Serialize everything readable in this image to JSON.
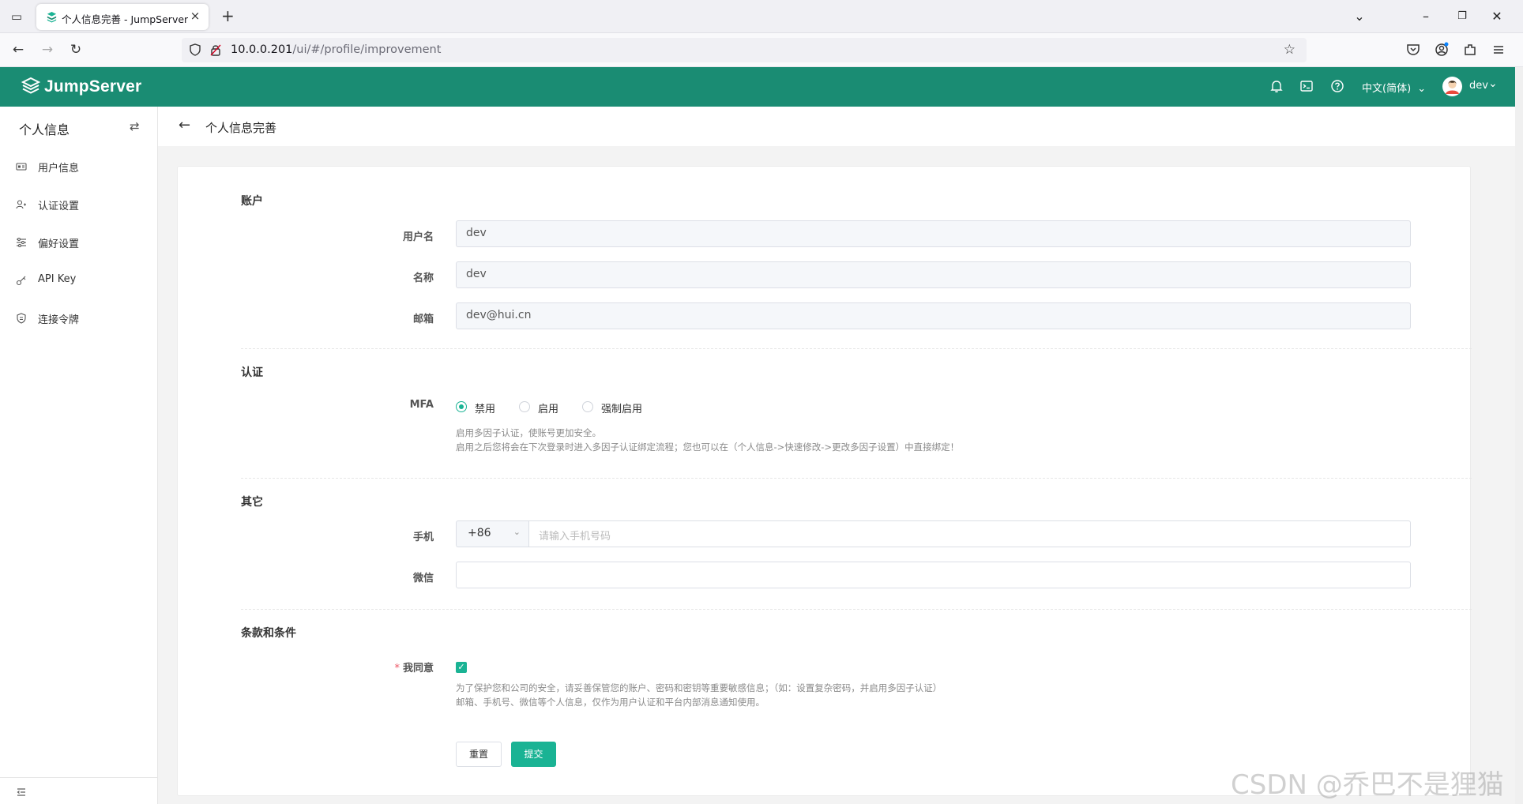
{
  "browser": {
    "tab_title": "个人信息完善 - JumpServer 开",
    "url_host": "10.0.0.201",
    "url_path": "/ui/#/profile/improvement"
  },
  "header": {
    "logo_text": "JumpServer",
    "language": "中文(简体)",
    "user": "dev",
    "icons": [
      "bell-icon",
      "terminal-icon",
      "help-icon"
    ]
  },
  "sidebar": {
    "title": "个人信息",
    "items": [
      {
        "label": "用户信息",
        "icon": "id-card-icon"
      },
      {
        "label": "认证设置",
        "icon": "user-key-icon"
      },
      {
        "label": "偏好设置",
        "icon": "sliders-icon"
      },
      {
        "label": "API Key",
        "icon": "key-icon"
      },
      {
        "label": "连接令牌",
        "icon": "token-icon"
      }
    ]
  },
  "page": {
    "title": "个人信息完善"
  },
  "form": {
    "account": {
      "title": "账户",
      "username_label": "用户名",
      "username": "dev",
      "name_label": "名称",
      "name": "dev",
      "email_label": "邮箱",
      "email": "dev@hui.cn"
    },
    "auth": {
      "title": "认证",
      "mfa_label": "MFA",
      "options": [
        "禁用",
        "启用",
        "强制启用"
      ],
      "selected": "禁用",
      "help_1": "启用多因子认证，使账号更加安全。",
      "help_2": "启用之后您将会在下次登录时进入多因子认证绑定流程；您也可以在（个人信息->快速修改->更改多因子设置）中直接绑定！"
    },
    "other": {
      "title": "其它",
      "phone_label": "手机",
      "phone_code": "+86",
      "phone_placeholder": "请输入手机号码",
      "wechat_label": "微信",
      "wechat": ""
    },
    "terms": {
      "title": "条款和条件",
      "agree_label": "我同意",
      "agree_required": "*",
      "agree_checked": true,
      "help_1": "为了保护您和公司的安全，请妥善保管您的账户、密码和密钥等重要敏感信息；（如：设置复杂密码，并启用多因子认证）",
      "help_2": "邮箱、手机号、微信等个人信息，仅作为用户认证和平台内部消息通知使用。"
    },
    "reset_label": "重置",
    "submit_label": "提交"
  },
  "watermark": "CSDN @乔巴不是狸猫",
  "colors": {
    "header": "#1a8c73",
    "primary": "#1ab394"
  }
}
